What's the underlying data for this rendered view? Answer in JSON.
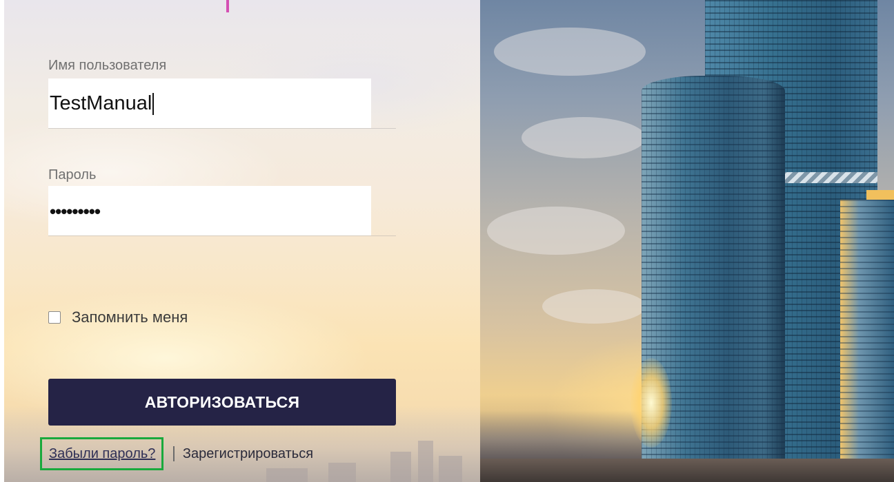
{
  "login_form": {
    "username_label": "Имя пользователя",
    "username_value": "TestManual",
    "password_label": "Пароль",
    "password_masked": "•••••••••",
    "remember_label": "Запомнить меня",
    "remember_checked": false,
    "submit_label": "АВТОРИЗОВАТЬСЯ",
    "forgot_label": "Забыли пароль?",
    "register_label": "Зарегистрироваться"
  },
  "colors": {
    "submit_background": "#252346",
    "highlight_border": "#19a93c",
    "accent_mark": "#d44fb3"
  },
  "images": {
    "hero_photo": "city-skyscrapers-sunset"
  }
}
